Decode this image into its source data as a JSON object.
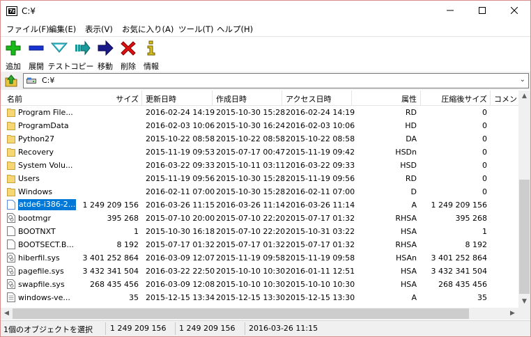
{
  "window": {
    "title": "C:¥"
  },
  "menu": [
    "ファイル(F)",
    "編集(E)",
    "表示(V)",
    "お気に入り(A)",
    "ツール(T)",
    "ヘルプ(H)"
  ],
  "toolbar": [
    {
      "label": "追加",
      "icon": "add-icon"
    },
    {
      "label": "展開",
      "icon": "extract-icon"
    },
    {
      "label": "テスト",
      "icon": "test-icon"
    },
    {
      "label": "コピー",
      "icon": "copy-icon"
    },
    {
      "label": "移動",
      "icon": "move-icon"
    },
    {
      "label": "削除",
      "icon": "delete-icon"
    },
    {
      "label": "情報",
      "icon": "info-icon"
    }
  ],
  "address": {
    "path": "C:¥"
  },
  "columns": [
    "名前",
    "サイズ",
    "更新日時",
    "作成日時",
    "アクセス日時",
    "属性",
    "圧縮後サイズ",
    "コメント"
  ],
  "rows": [
    {
      "type": "folder",
      "name": "Program File...",
      "size": "",
      "modified": "2016-02-24 14:19",
      "created": "2015-10-30 15:28",
      "accessed": "2016-02-24 14:19",
      "attr": "RD",
      "packed": "0"
    },
    {
      "type": "folder",
      "name": "ProgramData",
      "size": "",
      "modified": "2016-02-03 10:06",
      "created": "2015-10-30 16:24",
      "accessed": "2016-02-03 10:06",
      "attr": "HD",
      "packed": "0"
    },
    {
      "type": "folder",
      "name": "Python27",
      "size": "",
      "modified": "2015-10-22 08:58",
      "created": "2015-10-22 08:58",
      "accessed": "2015-10-22 08:58",
      "attr": "DA",
      "packed": "0"
    },
    {
      "type": "folder",
      "name": "Recovery",
      "size": "",
      "modified": "2015-11-19 09:53",
      "created": "2015-07-17 00:47",
      "accessed": "2015-11-19 09:42",
      "attr": "HSDn",
      "packed": "0"
    },
    {
      "type": "folder",
      "name": "System Volu...",
      "size": "",
      "modified": "2016-03-22 09:33",
      "created": "2015-10-11 03:11",
      "accessed": "2016-03-22 09:33",
      "attr": "HSD",
      "packed": "0"
    },
    {
      "type": "folder",
      "name": "Users",
      "size": "",
      "modified": "2015-11-19 09:56",
      "created": "2015-10-30 15:28",
      "accessed": "2015-11-19 09:56",
      "attr": "RD",
      "packed": "0"
    },
    {
      "type": "folder",
      "name": "Windows",
      "size": "",
      "modified": "2016-02-11 07:00",
      "created": "2015-10-30 15:28",
      "accessed": "2016-02-11 07:00",
      "attr": "D",
      "packed": "0"
    },
    {
      "type": "iso",
      "name": "atde6-i386-2...",
      "size": "1 249 209 156",
      "modified": "2016-03-26 11:15",
      "created": "2016-03-26 11:14",
      "accessed": "2016-03-26 11:14",
      "attr": "A",
      "packed": "1 249 209 156",
      "selected": true
    },
    {
      "type": "sys",
      "name": "bootmgr",
      "size": "395 268",
      "modified": "2015-07-10 20:00",
      "created": "2015-07-10 22:20",
      "accessed": "2015-07-17 01:32",
      "attr": "RHSA",
      "packed": "395 268"
    },
    {
      "type": "file",
      "name": "BOOTNXT",
      "size": "1",
      "modified": "2015-10-30 16:18",
      "created": "2015-07-10 22:20",
      "accessed": "2015-10-31 03:22",
      "attr": "HSA",
      "packed": "1"
    },
    {
      "type": "file",
      "name": "BOOTSECT.B...",
      "size": "8 192",
      "modified": "2015-07-17 01:32",
      "created": "2015-07-17 01:32",
      "accessed": "2015-07-17 01:32",
      "attr": "RHSA",
      "packed": "8 192"
    },
    {
      "type": "sys",
      "name": "hiberfil.sys",
      "size": "3 401 252 864",
      "modified": "2016-03-09 12:07",
      "created": "2015-11-19 09:58",
      "accessed": "2015-11-19 09:58",
      "attr": "HSAn",
      "packed": "3 401 252 864"
    },
    {
      "type": "sys",
      "name": "pagefile.sys",
      "size": "3 432 341 504",
      "modified": "2016-03-22 22:50",
      "created": "2015-10-10 10:30",
      "accessed": "2016-01-11 12:51",
      "attr": "HSA",
      "packed": "3 432 341 504"
    },
    {
      "type": "sys",
      "name": "swapfile.sys",
      "size": "268 435 456",
      "modified": "2016-03-09 12:08",
      "created": "2015-10-10 10:30",
      "accessed": "2015-10-10 10:30",
      "attr": "HSA",
      "packed": "268 435 456"
    },
    {
      "type": "text",
      "name": "windows-ve...",
      "size": "35",
      "modified": "2015-12-15 13:34",
      "created": "2015-12-15 13:30",
      "accessed": "2015-12-15 13:30",
      "attr": "A",
      "packed": "35"
    }
  ],
  "status": {
    "selection": "1個のオブジェクトを選択",
    "size": "1 249 209 156",
    "packed": "1 249 209 156",
    "modified": "2016-03-26 11:15"
  },
  "colors": {
    "selection": "#0078d7",
    "folder": "#f7d774"
  }
}
